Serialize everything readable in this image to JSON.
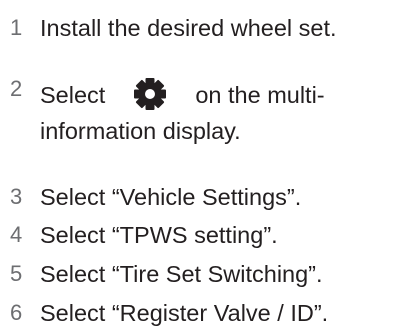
{
  "steps": [
    {
      "number": "1",
      "text": "Install the desired wheel set."
    },
    {
      "number": "2",
      "text_before": "Select",
      "icon": "gear-icon",
      "text_after": "on the multi-",
      "text_line2": "information display."
    },
    {
      "number": "3",
      "text": "Select “Vehicle Settings”."
    },
    {
      "number": "4",
      "text": "Select “TPWS setting”."
    },
    {
      "number": "5",
      "text": "Select “Tire Set Switching”."
    },
    {
      "number": "6",
      "text": "Select “Register Valve / ID”."
    }
  ],
  "colors": {
    "text": "#231f20",
    "number": "#6d6e71",
    "icon": "#231f20"
  }
}
